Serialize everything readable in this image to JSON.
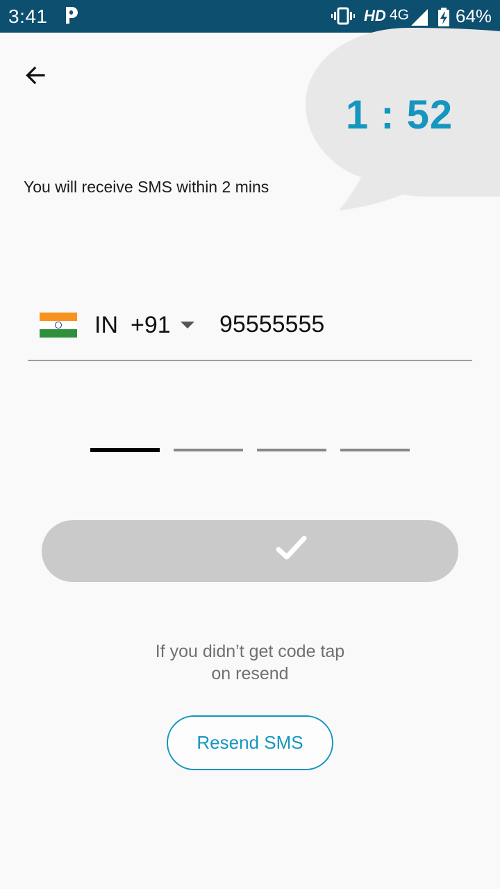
{
  "status_bar": {
    "time": "3:41",
    "network": "4G",
    "hd": "HD",
    "battery": "64%",
    "background_color": "#0d4f6e",
    "icons": [
      "p-icon",
      "vibrate-icon",
      "signal-icon",
      "battery-icon"
    ]
  },
  "header": {
    "back_icon": "arrow-left-icon",
    "countdown": "1 : 52"
  },
  "info": {
    "sms_message": "You will receive SMS within 2 mins"
  },
  "phone": {
    "flag_icon": "india-flag-icon",
    "country_code": "IN",
    "dial_code": "+91",
    "number": "95555555"
  },
  "otp": {
    "slots": 4,
    "active_slot": 1
  },
  "confirm": {
    "icon": "check-icon"
  },
  "resend": {
    "hint_line1": "If you didn’t get code tap",
    "hint_line2": "on resend",
    "button_label": "Resend SMS"
  },
  "colors": {
    "accent": "#1496bf",
    "background": "#f9f9f9",
    "disabled_button": "#cacaca",
    "bubble": "#e8e8e8"
  }
}
